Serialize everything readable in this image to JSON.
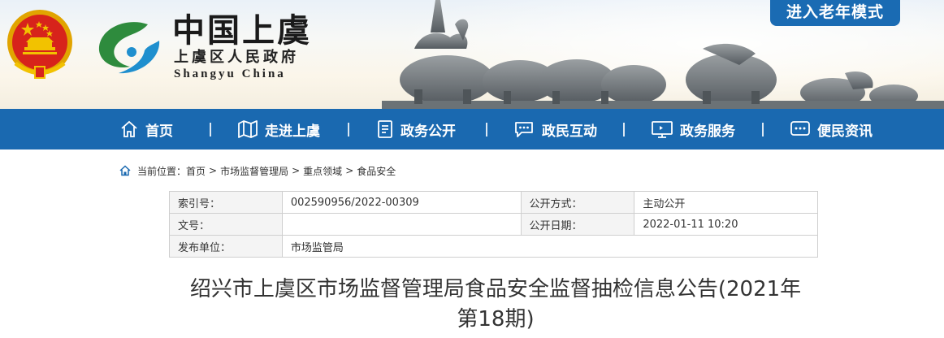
{
  "header": {
    "title": "中国上虞",
    "subtitle": "上虞区人民政府",
    "subtitle_en": "Shangyu  China",
    "elder_mode_label": "进入老年模式",
    "emblem_icon": "national-emblem-icon",
    "logo_icon": "shangyu-swirl-logo-icon"
  },
  "nav": {
    "items": [
      {
        "label": "首页",
        "icon": "home-icon"
      },
      {
        "label": "走进上虞",
        "icon": "map-icon"
      },
      {
        "label": "政务公开",
        "icon": "document-icon"
      },
      {
        "label": "政民互动",
        "icon": "chat-icon"
      },
      {
        "label": "政务服务",
        "icon": "monitor-icon"
      },
      {
        "label": "便民资讯",
        "icon": "message-icon"
      }
    ]
  },
  "breadcrumb": {
    "prefix": "当前位置：",
    "items": [
      "首页",
      "市场监督管理局",
      "重点领域",
      "食品安全"
    ],
    "separator": ">"
  },
  "meta": {
    "index_label": "索引号：",
    "index_value": "002590956/2022-00309",
    "open_mode_label": "公开方式：",
    "open_mode_value": "主动公开",
    "doc_no_label": "文号：",
    "doc_no_value": "",
    "open_date_label": "公开日期：",
    "open_date_value": "2022-01-11 10:20",
    "publisher_label": "发布单位：",
    "publisher_value": "市场监管局"
  },
  "article": {
    "title_line1": "绍兴市上虞区市场监督管理局食品安全监督抽检信息公告(2021年",
    "title_line2": "第18期)"
  },
  "colors": {
    "nav_blue": "#1a69b0",
    "elder_button_blue": "#1a6bb3",
    "emblem_red": "#d7231b",
    "emblem_gold": "#f2c200"
  }
}
